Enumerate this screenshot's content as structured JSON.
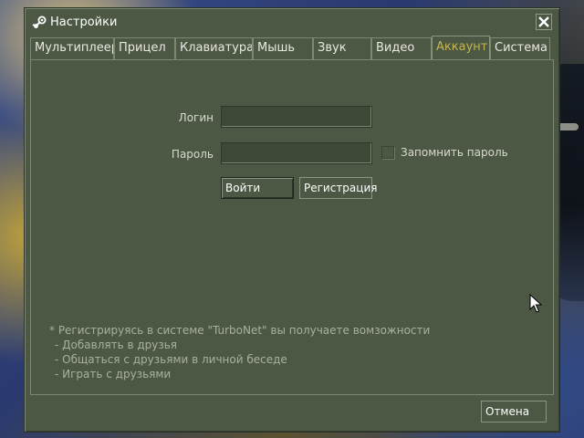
{
  "window": {
    "title": "Настройки",
    "icon": "steam-icon",
    "close_icon": "close-icon"
  },
  "tabs": [
    {
      "label": "Мультиплеер",
      "active": false
    },
    {
      "label": "Прицел",
      "active": false
    },
    {
      "label": "Клавиатура",
      "active": false
    },
    {
      "label": "Мышь",
      "active": false
    },
    {
      "label": "Звук",
      "active": false
    },
    {
      "label": "Видео",
      "active": false
    },
    {
      "label": "Аккаунт",
      "active": true
    },
    {
      "label": "Система",
      "active": false
    }
  ],
  "account": {
    "login_label": "Логин",
    "login_value": "",
    "password_label": "Пароль",
    "password_value": "",
    "remember_label": "Запомнить пароль",
    "remember_checked": false,
    "login_button": "Войти",
    "register_button": "Регистрация"
  },
  "info": {
    "lines": [
      "* Регистрируясь в системе \"TurboNet\" вы получаете вомзожности",
      "- Добавлять в друзья",
      "- Общаться с друзьями в личной беседе",
      "- Играть с друзьями"
    ]
  },
  "footer": {
    "cancel_button": "Отмена"
  },
  "colors": {
    "dialog_bg": "#4c5844",
    "active_tab_text": "#c4b550",
    "border_light": "#7c886f",
    "info_text": "#a9b09e"
  }
}
